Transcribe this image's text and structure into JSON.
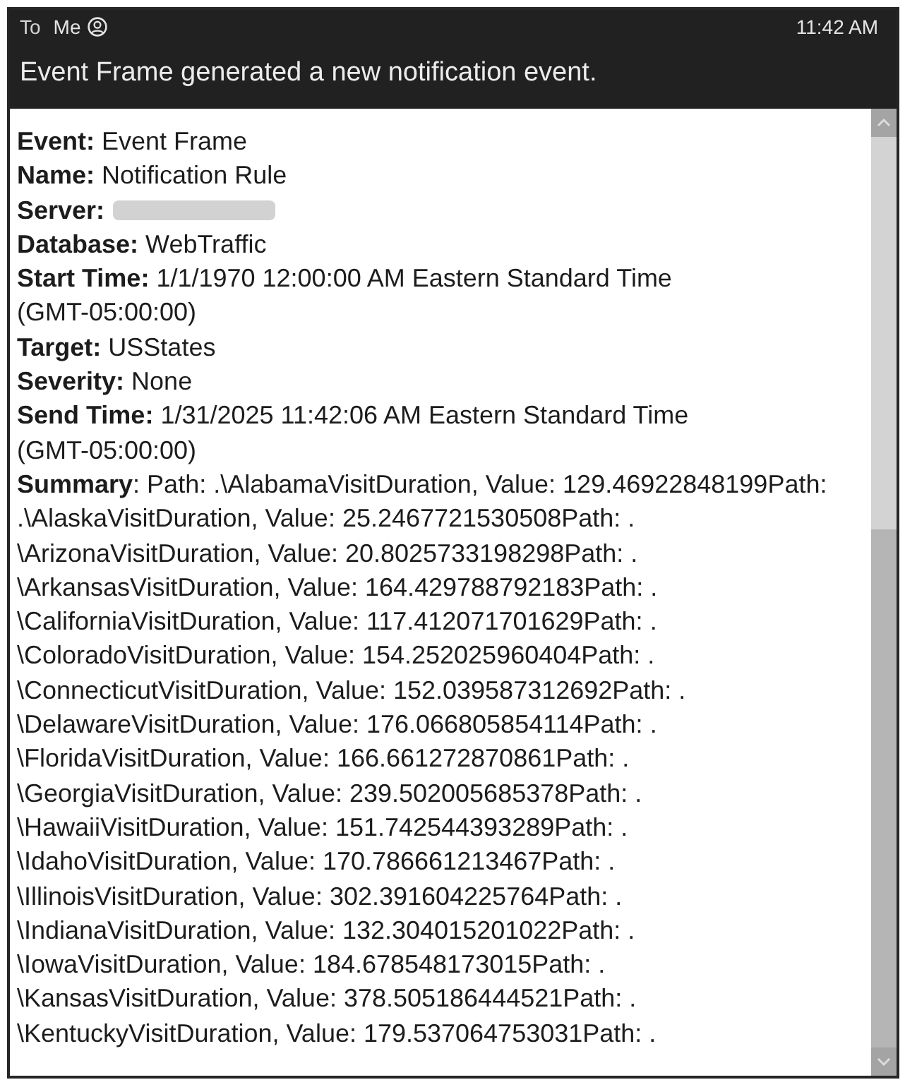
{
  "header": {
    "to_label": "To",
    "recipient": "Me",
    "time": "11:42 AM",
    "subject": "Event Frame generated a new notification event."
  },
  "fields": [
    {
      "kind": "text",
      "label": "Event:",
      "value": "Event Frame"
    },
    {
      "kind": "text",
      "label": "Name:",
      "value": "Notification Rule"
    },
    {
      "kind": "redacted",
      "label": "Server:"
    },
    {
      "kind": "text",
      "label": "Database:",
      "value": "WebTraffic"
    },
    {
      "kind": "text",
      "label": "Start Time:",
      "value": "1/1/1970 12:00:00 AM Eastern Standard Time",
      "continuation": "(GMT-05:00:00)"
    },
    {
      "kind": "text",
      "label": "Target:",
      "value": "USStates"
    },
    {
      "kind": "text",
      "label": "Severity:",
      "value": "None"
    },
    {
      "kind": "text",
      "label": "Send Time:",
      "value": "1/31/2025 11:42:06 AM Eastern Standard Time",
      "continuation": "(GMT-05:00:00)"
    }
  ],
  "summary_lines": [
    "**Summary**: Path: .\\AlabamaVisitDuration, Value: 129.46922848199Path:",
    ".\\AlaskaVisitDuration, Value: 25.2467721530508Path: .",
    "\\ArizonaVisitDuration, Value: 20.8025733198298Path: .",
    "\\ArkansasVisitDuration, Value: 164.429788792183Path: .",
    "\\CaliforniaVisitDuration, Value: 117.412071701629Path: .",
    "\\ColoradoVisitDuration, Value: 154.252025960404Path: .",
    "\\ConnecticutVisitDuration, Value: 152.039587312692Path: .",
    "\\DelawareVisitDuration, Value: 176.066805854114Path: .",
    "\\FloridaVisitDuration, Value: 166.661272870861Path: .",
    "\\GeorgiaVisitDuration, Value: 239.502005685378Path: .",
    "\\HawaiiVisitDuration, Value: 151.742544393289Path: .",
    "\\IdahoVisitDuration, Value: 170.786661213467Path: .",
    "\\IllinoisVisitDuration, Value: 302.391604225764Path: .",
    "\\IndianaVisitDuration, Value: 132.304015201022Path: .",
    "\\IowaVisitDuration, Value: 184.678548173015Path: .",
    "\\KansasVisitDuration, Value: 378.505186444521Path: .",
    "\\KentuckyVisitDuration, Value: 179.537064753031Path: ."
  ]
}
